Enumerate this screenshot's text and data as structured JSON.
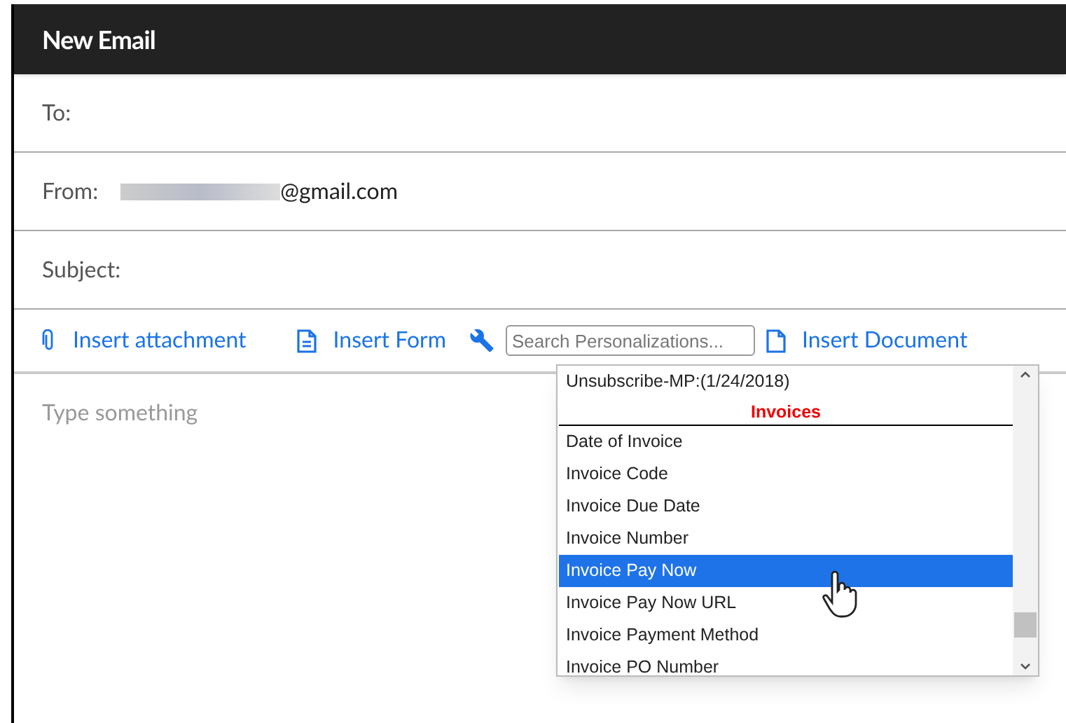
{
  "window": {
    "title": "New Email"
  },
  "fields": [
    {
      "label": "To:"
    },
    {
      "label": "From:",
      "redacted": true,
      "value": "@gmail.com"
    },
    {
      "label": "Subject:"
    }
  ],
  "toolbar": [
    {
      "kind": "attachment",
      "label": "Insert attachment"
    },
    {
      "kind": "form",
      "label": "Insert Form"
    },
    {
      "kind": "search",
      "placeholder": "Search Personalizations..."
    },
    {
      "kind": "document",
      "label": "Insert Document"
    }
  ],
  "editor": {
    "placeholder": "Type something"
  },
  "dropdown": {
    "items": [
      {
        "kind": "item",
        "label": "Unsubscribe-MP:(1/24/2018)",
        "selected": false
      },
      {
        "kind": "group",
        "label": "Invoices"
      },
      {
        "kind": "item",
        "label": "Date of Invoice",
        "selected": false
      },
      {
        "kind": "item",
        "label": "Invoice Code",
        "selected": false
      },
      {
        "kind": "item",
        "label": "Invoice Due Date",
        "selected": false
      },
      {
        "kind": "item",
        "label": "Invoice Number",
        "selected": false
      },
      {
        "kind": "item",
        "label": "Invoice Pay Now",
        "selected": true
      },
      {
        "kind": "item",
        "label": "Invoice Pay Now URL",
        "selected": false
      },
      {
        "kind": "item",
        "label": "Invoice Payment Method",
        "selected": false
      },
      {
        "kind": "item",
        "label": "Invoice PO Number",
        "selected": false
      }
    ]
  }
}
